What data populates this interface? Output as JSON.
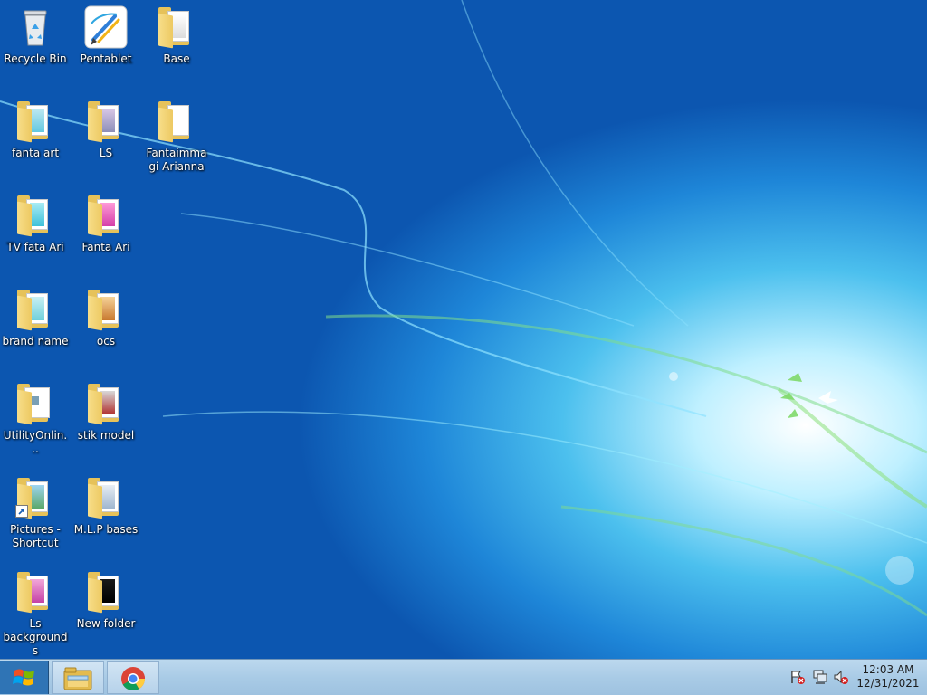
{
  "desktop": {
    "icons": [
      {
        "label": "Recycle Bin",
        "icon": "recycle-bin-icon"
      },
      {
        "label": "Pentablet",
        "icon": "pentablet-app-icon"
      },
      {
        "label": "Base",
        "icon": "folder-icon"
      },
      {
        "label": "fanta art",
        "icon": "folder-icon"
      },
      {
        "label": "LS",
        "icon": "folder-icon"
      },
      {
        "label": "Fantaimmagi Arianna",
        "icon": "folder-icon"
      },
      {
        "label": "TV  fata Ari",
        "icon": "folder-icon"
      },
      {
        "label": "Fanta Ari",
        "icon": "folder-icon"
      },
      {
        "label": "brand name",
        "icon": "folder-icon"
      },
      {
        "label": "ocs",
        "icon": "folder-icon"
      },
      {
        "label": "UtilityOnlin...",
        "icon": "file-icon"
      },
      {
        "label": "stik  model",
        "icon": "folder-icon"
      },
      {
        "label": "Pictures - Shortcut",
        "icon": "folder-shortcut-icon"
      },
      {
        "label": "M.L.P bases",
        "icon": "folder-icon"
      },
      {
        "label": "Ls backgrounds",
        "icon": "folder-icon"
      },
      {
        "label": "New folder",
        "icon": "folder-icon"
      }
    ]
  },
  "taskbar": {
    "start_icon": "windows-logo-icon",
    "pinned": [
      {
        "name": "file-explorer",
        "icon": "file-explorer-icon"
      },
      {
        "name": "google-chrome",
        "icon": "chrome-icon"
      }
    ],
    "tray": [
      {
        "name": "action-center",
        "icon": "action-center-flag-icon"
      },
      {
        "name": "network",
        "icon": "network-icon"
      },
      {
        "name": "volume",
        "icon": "volume-muted-icon"
      }
    ],
    "clock": {
      "time": "12:03 AM",
      "date": "12/31/2021"
    }
  },
  "colors": {
    "wallpaper_dark": "#0c56b0",
    "wallpaper_light": "#bff0ff",
    "folder": "#e6c25a",
    "taskbar": "#a9cbe6",
    "start": "#2f74b5"
  }
}
